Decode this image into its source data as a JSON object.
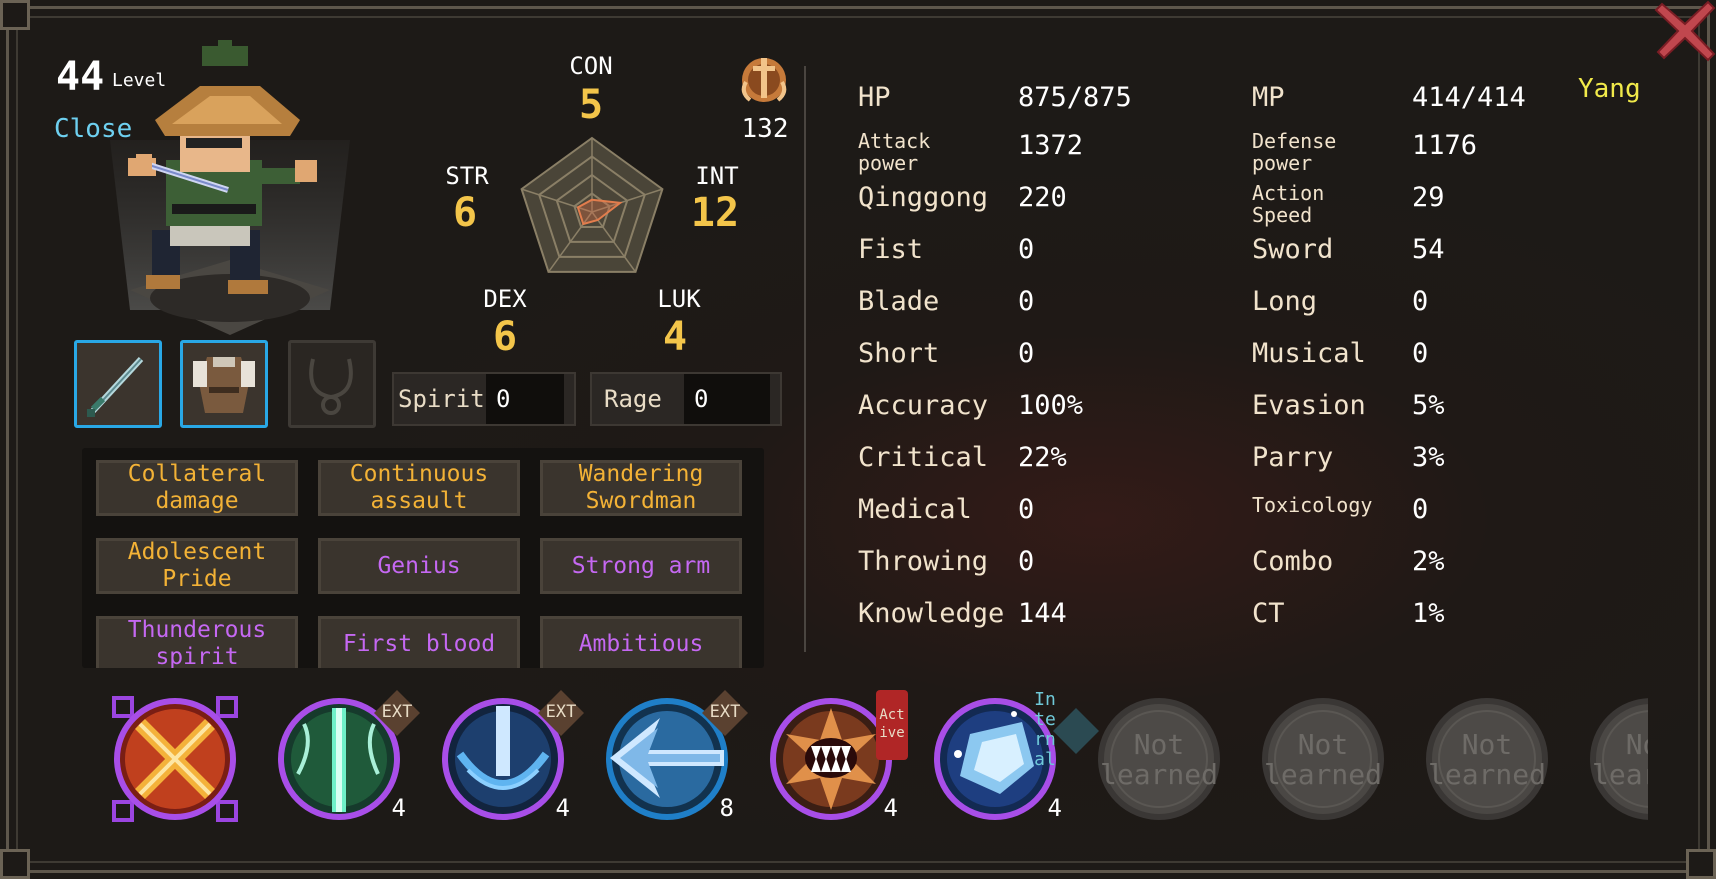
{
  "header": {
    "level": "44",
    "level_label": "Level",
    "close_label": "Close"
  },
  "reputation": {
    "value": "132"
  },
  "primary_stats": {
    "CON": {
      "label": "CON",
      "value": "5"
    },
    "STR": {
      "label": "STR",
      "value": "6"
    },
    "INT": {
      "label": "INT",
      "value": "12"
    },
    "DEX": {
      "label": "DEX",
      "value": "6"
    },
    "LUK": {
      "label": "LUK",
      "value": "4"
    }
  },
  "radar": {
    "CON": 5,
    "INT": 12,
    "LUK": 4,
    "DEX": 6,
    "STR": 6
  },
  "resources": {
    "spirit": {
      "label": "Spirit",
      "value": "0"
    },
    "rage": {
      "label": "Rage",
      "value": "0"
    }
  },
  "traits": [
    {
      "label": "Collateral damage",
      "color": "#f3b236"
    },
    {
      "label": "Continuous assault",
      "color": "#f3b236"
    },
    {
      "label": "Wandering Swordman",
      "color": "#f3b236"
    },
    {
      "label": "Adolescent Pride",
      "color": "#f3b236"
    },
    {
      "label": "Genius",
      "color": "#c568f2"
    },
    {
      "label": "Strong arm",
      "color": "#c568f2"
    },
    {
      "label": "Thunderous spirit",
      "color": "#c568f2"
    },
    {
      "label": "First blood",
      "color": "#c568f2"
    },
    {
      "label": "Ambitious",
      "color": "#c568f2"
    }
  ],
  "attributes_left": [
    {
      "label": "HP",
      "value": "875/875"
    },
    {
      "label": "Attack power",
      "value": "1372",
      "small": true
    },
    {
      "label": "Qinggong",
      "value": "220"
    },
    {
      "label": "Fist",
      "value": "0"
    },
    {
      "label": "Blade",
      "value": "0"
    },
    {
      "label": "Short",
      "value": "0"
    },
    {
      "label": "Accuracy",
      "value": "100%"
    },
    {
      "label": "Critical",
      "value": "22%"
    },
    {
      "label": "Medical",
      "value": "0"
    },
    {
      "label": "Throwing",
      "value": "0"
    },
    {
      "label": "Knowledge",
      "value": "144"
    }
  ],
  "attributes_right": [
    {
      "label": "MP",
      "value": "414/414"
    },
    {
      "label": "Defense power",
      "value": "1176",
      "small": true
    },
    {
      "label": "Action Speed",
      "value": "29",
      "small": true
    },
    {
      "label": "Sword",
      "value": "54"
    },
    {
      "label": "Long",
      "value": "0"
    },
    {
      "label": "Musical",
      "value": "0"
    },
    {
      "label": "Evasion",
      "value": "5%"
    },
    {
      "label": "Parry",
      "value": "3%"
    },
    {
      "label": "Toxicology",
      "value": "0",
      "small": true
    },
    {
      "label": "Combo",
      "value": "2%"
    },
    {
      "label": "CT",
      "value": "1%"
    }
  ],
  "alignment": "Yang",
  "skills": [
    {
      "name": "crossed-swords-skill",
      "count": "",
      "tag": ""
    },
    {
      "name": "green-sword-skill",
      "count": "4",
      "tag": "EXT"
    },
    {
      "name": "blue-sword-skill",
      "count": "4",
      "tag": "EXT"
    },
    {
      "name": "ice-arrow-skill",
      "count": "8",
      "tag": "EXT"
    },
    {
      "name": "fanged-mouth-skill",
      "count": "4",
      "tag": "Active"
    },
    {
      "name": "frost-orb-skill",
      "count": "4",
      "tag": "Internal"
    }
  ],
  "locked_skills": {
    "label": "Not learned",
    "count": 4
  },
  "icons": {
    "close": "close-x-icon",
    "reputation": "sword-emblem-icon",
    "weapon": "sword-icon",
    "armor": "robe-icon",
    "accessory": "necklace-icon"
  }
}
